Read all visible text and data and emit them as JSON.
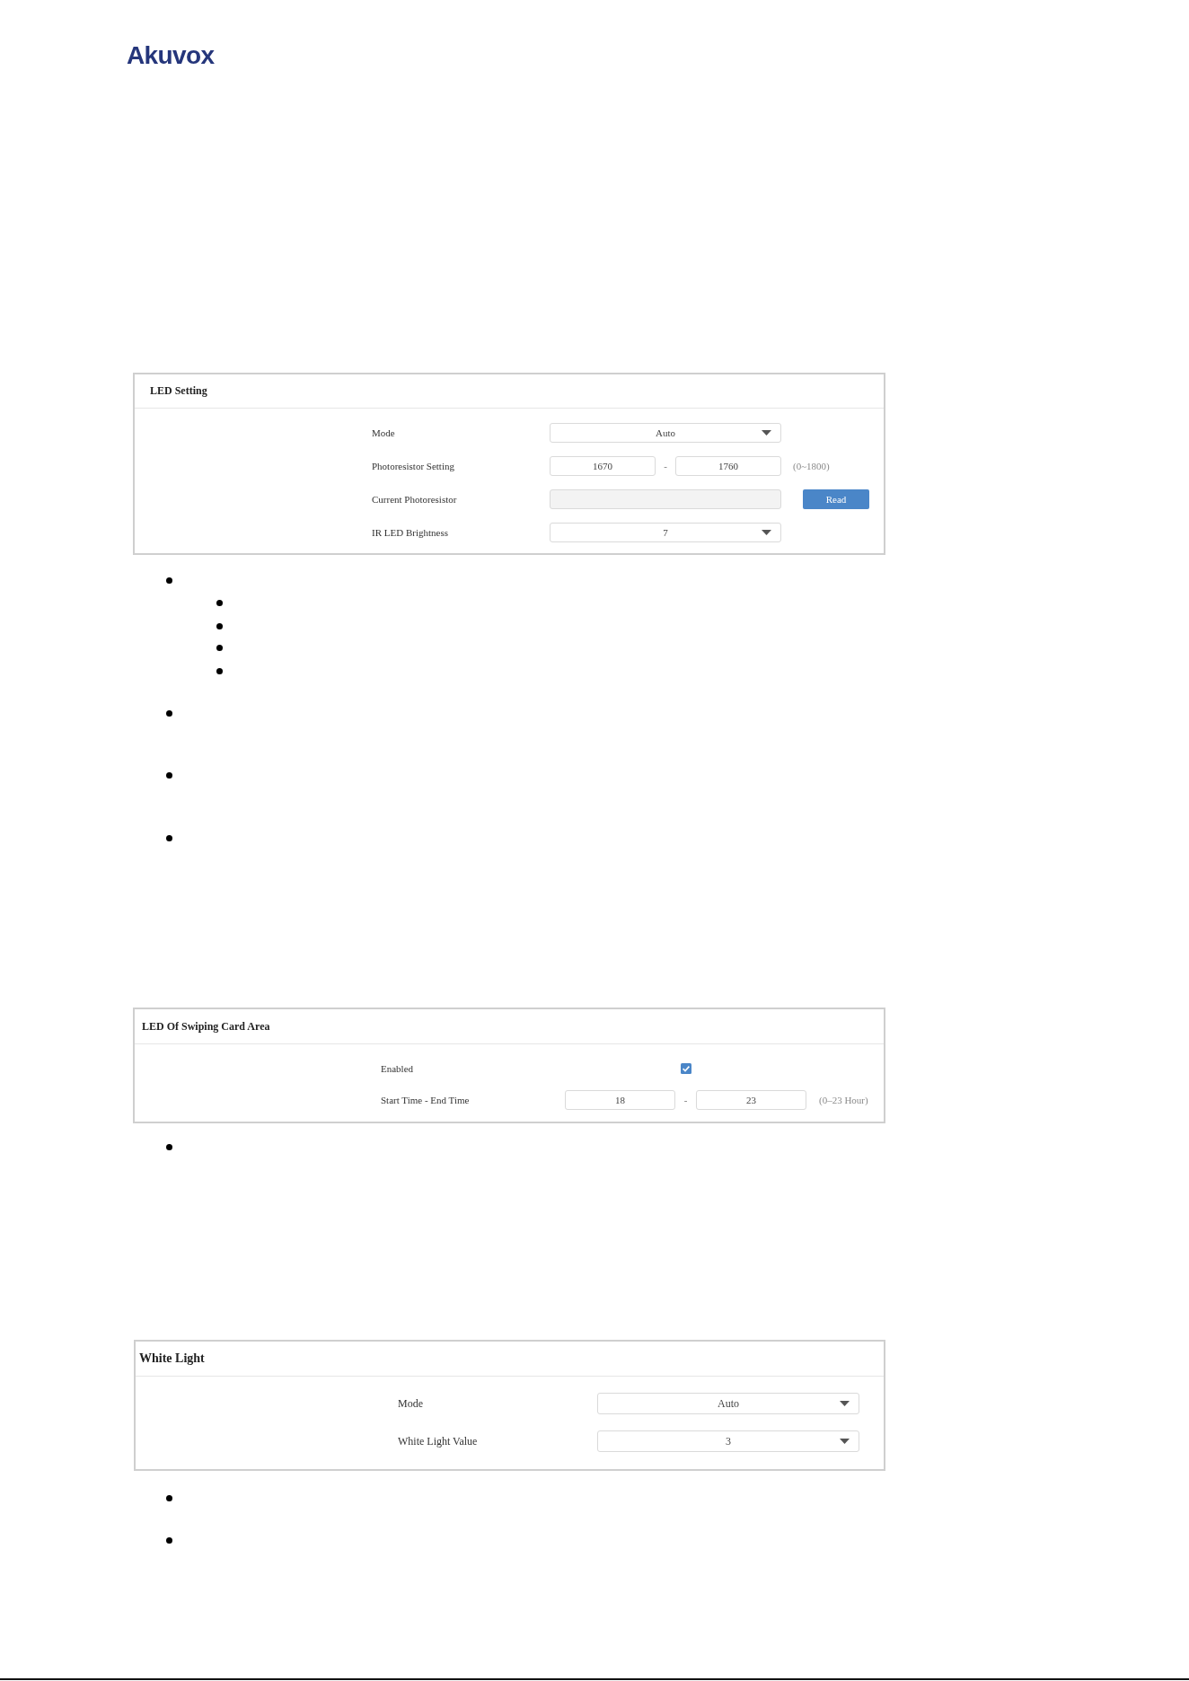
{
  "logo": {
    "text": "Akuvox"
  },
  "panels": [
    {
      "title": "LED Setting",
      "rows": [
        {
          "kind": "select",
          "label": "Mode",
          "value": "Auto"
        },
        {
          "kind": "range",
          "label": "Photoresistor Setting",
          "from": "1670",
          "separator": "-",
          "to": "1760",
          "hint": "(0~1800)"
        },
        {
          "kind": "readout",
          "label": "Current Photoresistor",
          "button": "Read"
        },
        {
          "kind": "select",
          "label": "IR LED Brightness",
          "value": "7"
        }
      ]
    },
    {
      "title": "LED Of Swiping Card Area",
      "rows": [
        {
          "kind": "checkbox",
          "label": "Enabled",
          "checked": true
        },
        {
          "kind": "range",
          "label": "Start Time - End Time",
          "from": "18",
          "separator": "-",
          "to": "23",
          "hint": "(0–23 Hour)"
        }
      ]
    },
    {
      "title": "White Light",
      "rows": [
        {
          "kind": "select",
          "label": "Mode",
          "value": "Auto"
        },
        {
          "kind": "select",
          "label": "White Light Value",
          "value": "3"
        }
      ]
    }
  ]
}
